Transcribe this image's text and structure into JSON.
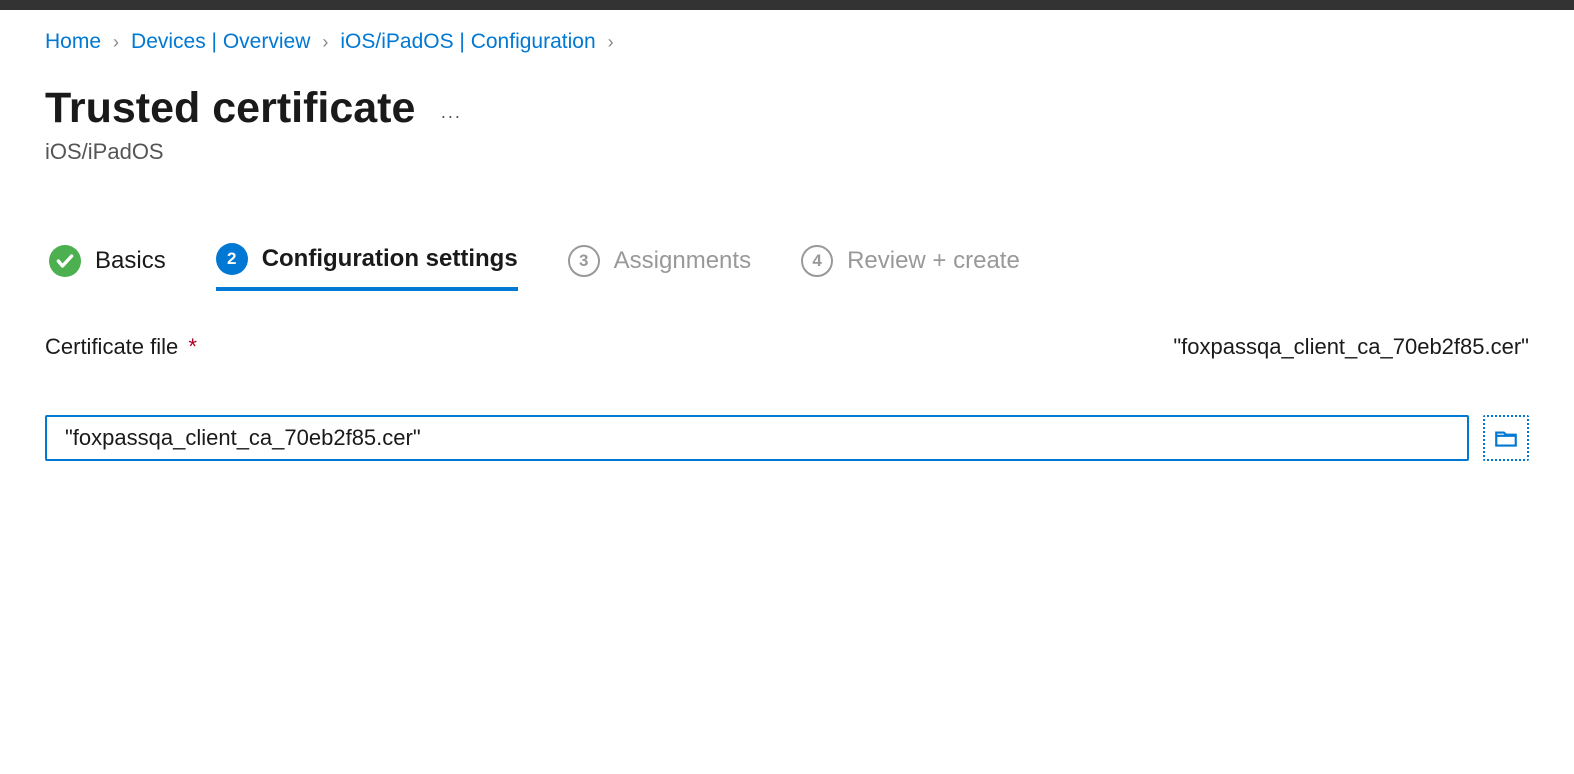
{
  "breadcrumb": {
    "items": [
      {
        "label": "Home"
      },
      {
        "label": "Devices | Overview"
      },
      {
        "label": "iOS/iPadOS | Configuration"
      }
    ]
  },
  "header": {
    "title": "Trusted certificate",
    "subtitle": "iOS/iPadOS",
    "more": "···"
  },
  "steps": [
    {
      "label": "Basics",
      "state": "completed"
    },
    {
      "label": "Configuration settings",
      "number": "2",
      "state": "current"
    },
    {
      "label": "Assignments",
      "number": "3",
      "state": "pending"
    },
    {
      "label": "Review + create",
      "number": "4",
      "state": "pending"
    }
  ],
  "form": {
    "certificate_file_label": "Certificate file",
    "certificate_file_value_display": "\"foxpassqa_client_ca_70eb2f85.cer\"",
    "certificate_file_input_value": "\"foxpassqa_client_ca_70eb2f85.cer\""
  }
}
